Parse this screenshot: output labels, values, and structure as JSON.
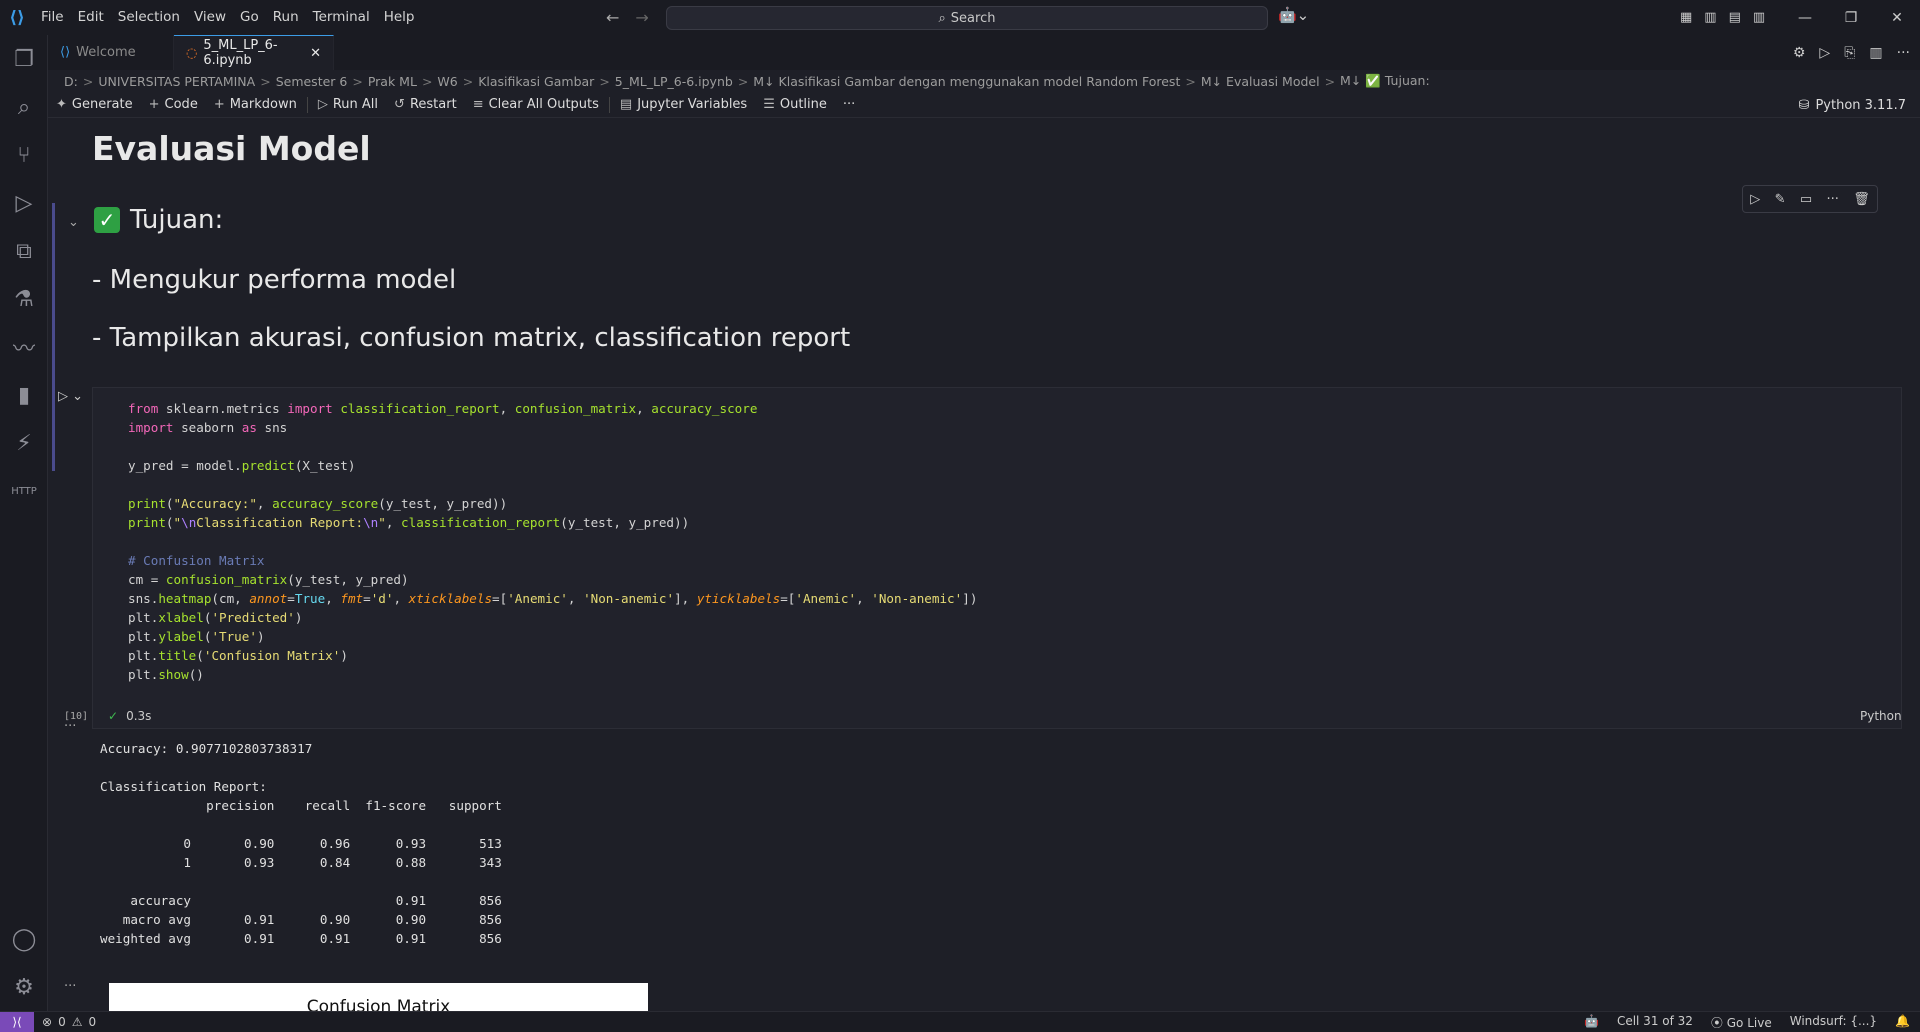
{
  "menu": [
    "File",
    "Edit",
    "Selection",
    "View",
    "Go",
    "Run",
    "Terminal",
    "Help"
  ],
  "search": {
    "label": "Search"
  },
  "tabs": [
    {
      "label": "Welcome"
    },
    {
      "label": "5_ML_LP_6-6.ipynb"
    }
  ],
  "breadcrumb": [
    "D:",
    "UNIVERSITAS PERTAMINA",
    "Semester 6",
    "Prak ML",
    "W6",
    "Klasifikasi Gambar",
    "5_ML_LP_6-6.ipynb",
    "M↓ Klasifikasi Gambar dengan menggunakan model Random Forest",
    "M↓ Evaluasi Model",
    "M↓ ✅ Tujuan:"
  ],
  "toolbar": {
    "generate": "Generate",
    "code": "Code",
    "markdown": "Markdown",
    "run_all": "Run All",
    "restart": "Restart",
    "clear_outputs": "Clear All Outputs",
    "jupyter_variables": "Jupyter Variables",
    "outline": "Outline",
    "more": "···",
    "kernel": "Python 3.11.7"
  },
  "markdown": {
    "heading": "Evaluasi Model",
    "tujuan": "Tujuan:",
    "item1": "- Mengukur performa model",
    "item2": "- Tampilkan akurasi, confusion matrix, classification report"
  },
  "cell": {
    "exec_count": "[10]",
    "duration": "0.3s",
    "language": "Python"
  },
  "output": {
    "accuracy": "Accuracy: 0.9077102803738317",
    "report_title": "Classification Report:",
    "report_header": "              precision    recall  f1-score   support",
    "row_0": "           0       0.90      0.96      0.93       513",
    "row_1": "           1       0.93      0.84      0.88       343",
    "row_accuracy": "    accuracy                           0.91       856",
    "row_macro": "   macro avg       0.91      0.90      0.90       856",
    "row_weighted": "weighted avg       0.91      0.91      0.91       856",
    "plot_title": "Confusion Matrix"
  },
  "statusbar": {
    "errors": "0",
    "warnings": "0",
    "cell_pos": "Cell 31 of 32",
    "go_live": "Go Live",
    "windsurf": "Windsurf: {...}"
  }
}
